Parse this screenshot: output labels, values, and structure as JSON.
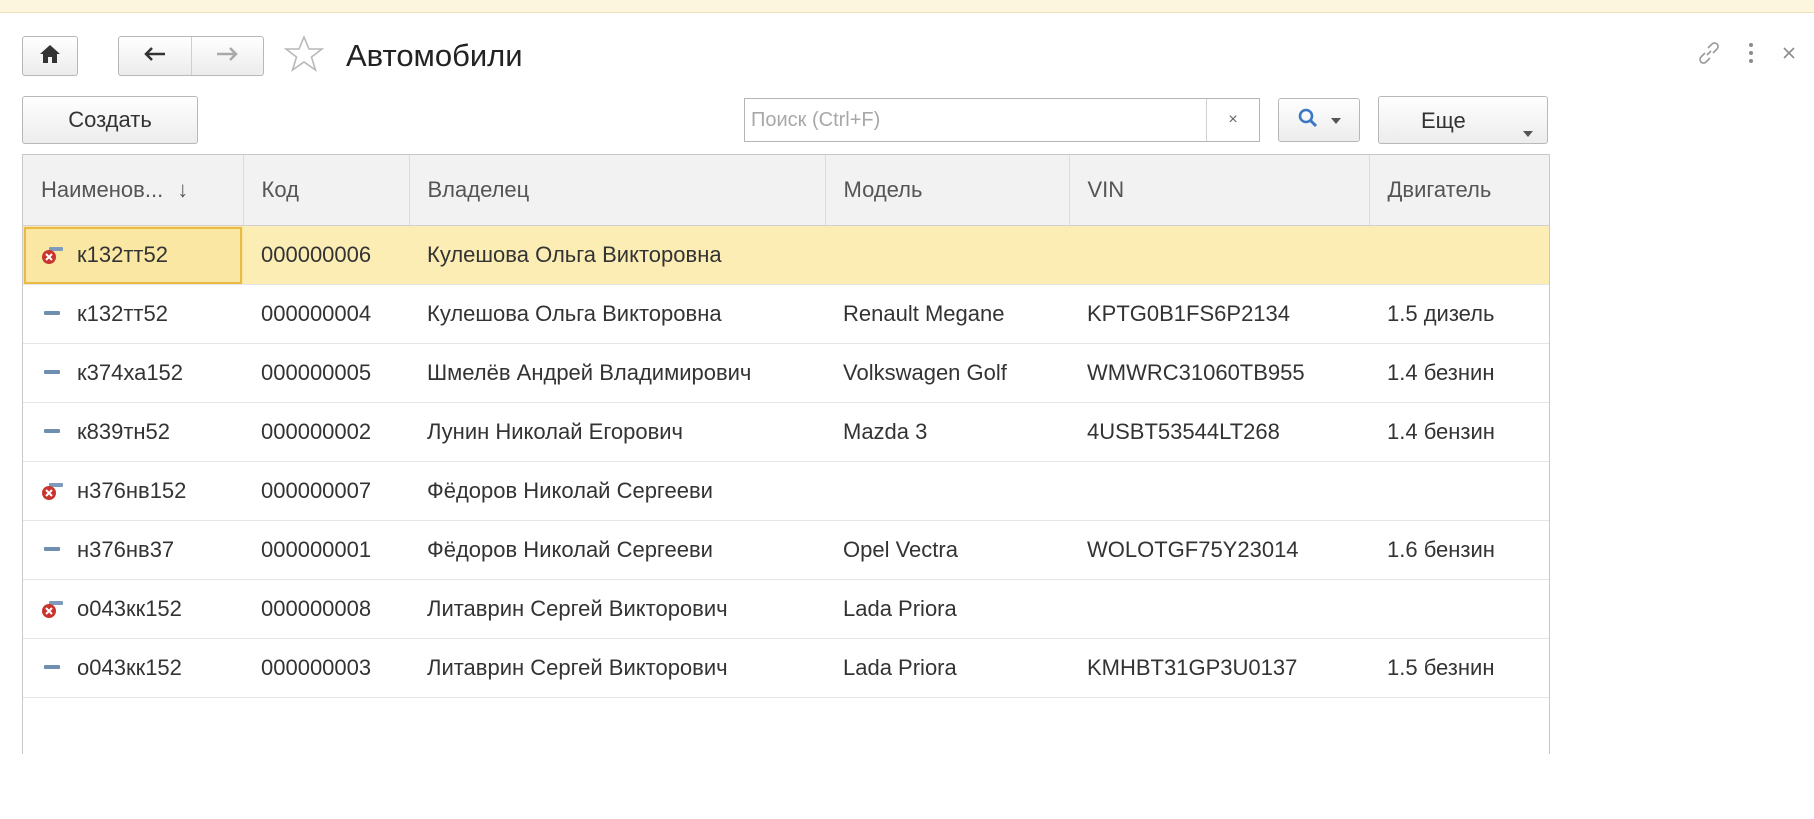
{
  "window": {
    "title": "Автомобили",
    "home_icon": "home-icon",
    "back_icon": "arrow-left-icon",
    "forward_icon": "arrow-right-icon",
    "favorite_icon": "star-icon",
    "link_icon": "link-icon",
    "menu_icon": "kebab-menu-icon",
    "close_icon": "close-icon"
  },
  "toolbar": {
    "create_label": "Создать",
    "search_placeholder": "Поиск (Ctrl+F)",
    "search_value": "",
    "clear_symbol": "×",
    "more_label": "Еще"
  },
  "table": {
    "columns": [
      "Наименов...",
      "Код",
      "Владелец",
      "Модель",
      "VIN",
      "Двигатель"
    ],
    "sort_column": "Наименов...",
    "sort_direction": "descending-arrow",
    "rows": [
      {
        "name": "к132тт52",
        "code": "000000006",
        "owner": "Кулешова Ольга Викторовна",
        "model": "",
        "vin": "",
        "engine": "",
        "status": "marked-for-deletion",
        "selected": true
      },
      {
        "name": "к132тт52",
        "code": "000000004",
        "owner": "Кулешова Ольга Викторовна",
        "model": "Renault Megane",
        "vin": "KPTG0B1FS6P2134",
        "engine": "1.5 дизель",
        "status": "normal",
        "selected": false
      },
      {
        "name": "к374ха152",
        "code": "000000005",
        "owner": "Шмелёв Андрей Владимирович",
        "model": "Volkswagen Golf",
        "vin": "WMWRC31060TB955",
        "engine": "1.4 безнин",
        "status": "normal",
        "selected": false
      },
      {
        "name": "к839тн52",
        "code": "000000002",
        "owner": "Лунин Николай Егорович",
        "model": "Mazda 3",
        "vin": "4USBT53544LT268",
        "engine": "1.4 бензин",
        "status": "normal",
        "selected": false
      },
      {
        "name": "н376нв152",
        "code": "000000007",
        "owner": "Фёдоров Николай Сергееви",
        "model": "",
        "vin": "",
        "engine": "",
        "status": "marked-for-deletion",
        "selected": false
      },
      {
        "name": "н376нв37",
        "code": "000000001",
        "owner": "Фёдоров Николай Сергееви",
        "model": "Opel Vectra",
        "vin": "WOLOTGF75Y23014",
        "engine": "1.6 бензин",
        "status": "normal",
        "selected": false
      },
      {
        "name": "о043кк152",
        "code": "000000008",
        "owner": "Литаврин Сергей Викторович",
        "model": "Lada Priora",
        "vin": "",
        "engine": "",
        "status": "marked-for-deletion",
        "selected": false
      },
      {
        "name": "о043кк152",
        "code": "000000003",
        "owner": "Литаврин Сергей Викторович",
        "model": "Lada Priora",
        "vin": "KMHBT31GP3U0137",
        "engine": "1.5 безнин",
        "status": "normal",
        "selected": false
      }
    ]
  },
  "colors": {
    "selection_row": "#fcedb5",
    "selection_border": "#e9ba44",
    "header_bg": "#f2f2f2",
    "status_normal": "#6f8fb0",
    "status_deleted": "#c8352c"
  }
}
